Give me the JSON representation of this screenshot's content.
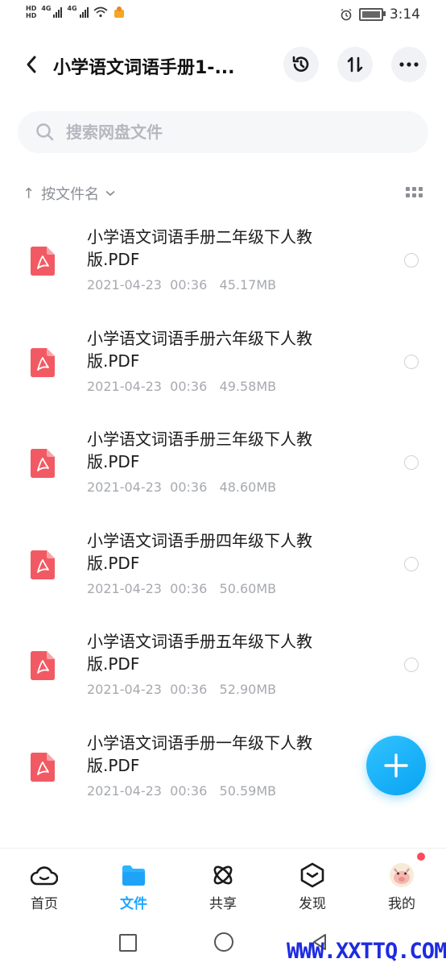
{
  "status_bar": {
    "hd1": "HD",
    "hd2": "HD",
    "net1": "4G",
    "net2": "4G",
    "time": "3:14",
    "battery_level": 0.9
  },
  "header": {
    "title": "小学语文词语手册1-...",
    "back_icon": "chevron-left-icon",
    "history_icon": "history-icon",
    "sort_icon": "sort-arrows-icon",
    "more_icon": "more-dots-icon"
  },
  "search": {
    "placeholder": "搜索网盘文件"
  },
  "sort": {
    "arrow": "↑",
    "label": "按文件名"
  },
  "files": [
    {
      "name": "小学语文词语手册二年级下人教版.PDF",
      "meta": "2021-04-23  00:36   45.17MB"
    },
    {
      "name": "小学语文词语手册六年级下人教版.PDF",
      "meta": "2021-04-23  00:36   49.58MB"
    },
    {
      "name": "小学语文词语手册三年级下人教版.PDF",
      "meta": "2021-04-23  00:36   48.60MB"
    },
    {
      "name": "小学语文词语手册四年级下人教版.PDF",
      "meta": "2021-04-23  00:36   50.60MB"
    },
    {
      "name": "小学语文词语手册五年级下人教版.PDF",
      "meta": "2021-04-23  00:36   52.90MB"
    },
    {
      "name": "小学语文词语手册一年级下人教版.PDF",
      "meta": "2021-04-23  00:36   50.59MB"
    }
  ],
  "bottom_nav": [
    {
      "label": "首页",
      "icon": "cloud-home-icon"
    },
    {
      "label": "文件",
      "icon": "folder-icon",
      "active": true
    },
    {
      "label": "共享",
      "icon": "atom-share-icon"
    },
    {
      "label": "发现",
      "icon": "discover-box-icon"
    },
    {
      "label": "我的",
      "icon": "avatar-icon"
    }
  ],
  "watermark": "WWW.XXTTQ.COM",
  "colors": {
    "accent": "#1fa6ff",
    "pdf_red": "#f25a63",
    "badge": "#ff4a5c"
  }
}
